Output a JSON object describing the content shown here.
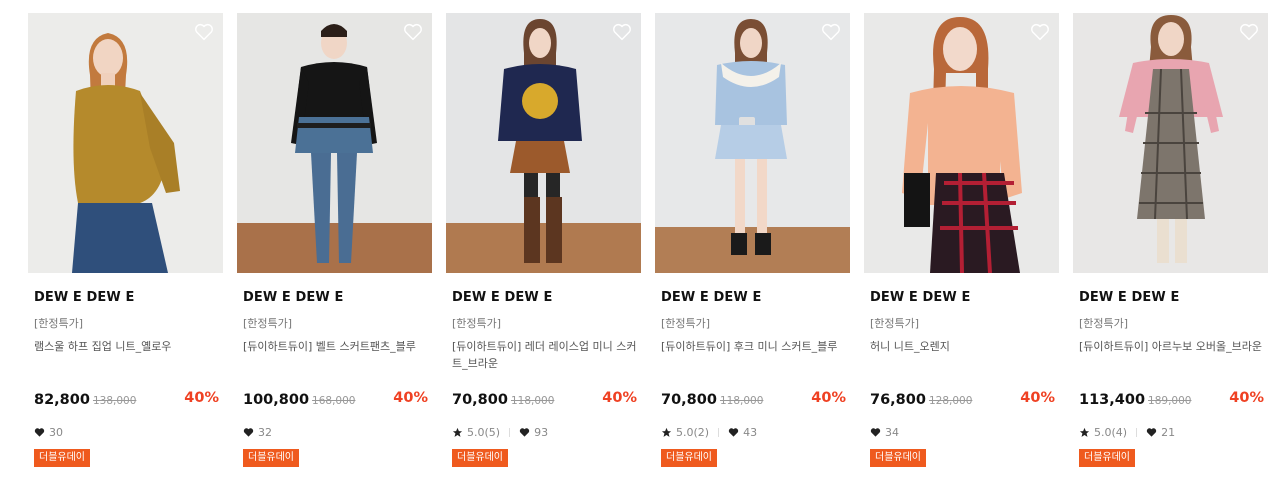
{
  "colors": {
    "discount": "#ef4123",
    "badge": "#ef5a1e",
    "text": "#111111"
  },
  "products": [
    {
      "brand": "DEW E DEW E",
      "tag": "[한정특가]",
      "name": "램스울 하프 집업 니트_옐로우",
      "price": "82,800",
      "original_price": "138,000",
      "discount": "40%",
      "rating": "",
      "likes": "30",
      "badge": "더블유데이",
      "wish_icon": "heart-outline-icon"
    },
    {
      "brand": "DEW E DEW E",
      "tag": "[한정특가]",
      "name": "[듀이하트듀이] 벨트 스커트팬츠_블루",
      "price": "100,800",
      "original_price": "168,000",
      "discount": "40%",
      "rating": "",
      "likes": "32",
      "badge": "더블유데이",
      "wish_icon": "heart-outline-icon"
    },
    {
      "brand": "DEW E DEW E",
      "tag": "[한정특가]",
      "name": "[듀이하트듀이] 레더 레이스업 미니 스커트_브라운",
      "price": "70,800",
      "original_price": "118,000",
      "discount": "40%",
      "rating": "5.0(5)",
      "likes": "93",
      "badge": "더블유데이",
      "wish_icon": "heart-outline-icon"
    },
    {
      "brand": "DEW E DEW E",
      "tag": "[한정특가]",
      "name": "[듀이하트듀이] 후크 미니 스커트_블루",
      "price": "70,800",
      "original_price": "118,000",
      "discount": "40%",
      "rating": "5.0(2)",
      "likes": "43",
      "badge": "더블유데이",
      "wish_icon": "heart-outline-icon"
    },
    {
      "brand": "DEW E DEW E",
      "tag": "[한정특가]",
      "name": "허니 니트_오렌지",
      "price": "76,800",
      "original_price": "128,000",
      "discount": "40%",
      "rating": "",
      "likes": "34",
      "badge": "더블유데이",
      "wish_icon": "heart-outline-icon"
    },
    {
      "brand": "DEW E DEW E",
      "tag": "[한정특가]",
      "name": "[듀이하트듀이] 아르누보 오버올_브라운",
      "price": "113,400",
      "original_price": "189,000",
      "discount": "40%",
      "rating": "5.0(4)",
      "likes": "21",
      "badge": "더블유데이",
      "wish_icon": "heart-outline-icon"
    }
  ]
}
